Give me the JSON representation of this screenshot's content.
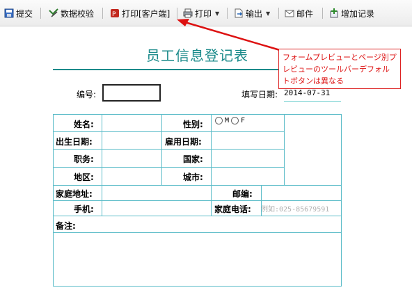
{
  "toolbar": {
    "submit": "提交",
    "check": "数据校验",
    "print_client": "打印[客户端]",
    "print": "打印",
    "export": "输出",
    "mail": "邮件",
    "add_record": "增加记录"
  },
  "form": {
    "title": "员工信息登记表",
    "code_label": "编号:",
    "date_label": "填写日期:",
    "date_value": "2014-07-31",
    "name": "姓名:",
    "gender": "性别:",
    "gender_options": [
      "M",
      "F"
    ],
    "birth": "出生日期:",
    "hire": "雇用日期:",
    "position": "职务:",
    "country": "国家:",
    "region": "地区:",
    "city": "城市:",
    "address": "家庭地址:",
    "zip": "邮编:",
    "mobile": "手机:",
    "home_phone": "家庭电话:",
    "home_phone_placeholder": "例如:025-85679591",
    "remarks": "备注:"
  },
  "annotation": {
    "text": "フォームプレビューとページ別プレビューのツールバーデフォルトボタンは異なる"
  },
  "colors": {
    "accent": "#1a8a8a",
    "grid": "#5bbcc8",
    "annotation": "#dd1111"
  }
}
